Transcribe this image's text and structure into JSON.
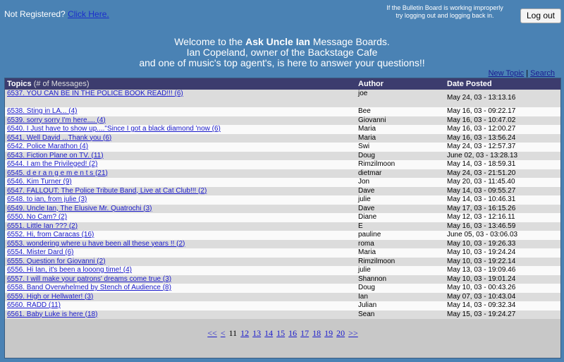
{
  "header": {
    "not_registered": "Not Registered?",
    "click_here": "Click Here.",
    "warning_line1": "If the Bulletin Board is working improperly",
    "warning_line2": "try logging out and logging back in.",
    "logout": "Log out"
  },
  "welcome": {
    "line1_pre": "Welcome to the ",
    "line1_bold": "Ask Uncle Ian",
    "line1_post": " Message Boards.",
    "line2": "Ian Copeland, owner of the Backstage Cafe",
    "line3": "and one of music's top agent's, is here to answer your questions!!"
  },
  "links": {
    "new_topic": "New Topic",
    "sep": "|",
    "search": "Search"
  },
  "table": {
    "col_topics": "Topics",
    "col_topics_sub": "(# of Messages)",
    "col_author": "Author",
    "col_date": "Date Posted",
    "rows": [
      {
        "topic": "6537. YOU CAN BE IN THE POLICE BOOK READ!!! (6)",
        "author": "joe",
        "date": "May 24, 03  -  13:13.16"
      },
      {
        "topic": "6538. Sting in LA... (4)",
        "author": "Bee",
        "date": "May 16, 03  -  09:22.17"
      },
      {
        "topic": "6539. sorry sorry I'm here.... (4)",
        "author": "Giovanni",
        "date": "May 16, 03  -  10:47.02"
      },
      {
        "topic": "6540. I Just have to show up....\"Since I got a black diamond 'now (6)",
        "author": "Maria",
        "date": "May 16, 03  -  12:00.27"
      },
      {
        "topic": "6541. Well David ...Thank you (6)",
        "author": "Maria",
        "date": "May 16, 03  -  13:56.24"
      },
      {
        "topic": "6542. Police Marathon (4)",
        "author": "Swi",
        "date": "May 24, 03  -  12:57.37"
      },
      {
        "topic": "6543. Fiction Plane on TV. (11)",
        "author": "Doug",
        "date": "June 02, 03  -  13:28.13"
      },
      {
        "topic": "6544. I am the Privileged! (2)",
        "author": "Rimzilmoon",
        "date": "May 14, 03  -  18:59.31"
      },
      {
        "topic": "6545. d e r a n g e m e n t s (21)",
        "author": "dietmar",
        "date": "May 24, 03  -  21:51.20"
      },
      {
        "topic": "6546. Kim Turner (9)",
        "author": "Jon",
        "date": "May 20, 03  -  11:45.40"
      },
      {
        "topic": "6547. FALLOUT: The Police Tribute Band, Live at Cat Club!!! (2)",
        "author": "Dave",
        "date": "May 14, 03  -  09:55.27"
      },
      {
        "topic": "6548. to ian, from julie (3)",
        "author": "julie",
        "date": "May 14, 03  -  10:46.31"
      },
      {
        "topic": "6549. Uncle Ian, The Elusive Mr. Quatrochi (3)",
        "author": "Dave",
        "date": "May 17, 03  -  16:15.26"
      },
      {
        "topic": "6550. No Cam? (2)",
        "author": "Diane",
        "date": "May 12, 03  -  12:16.11"
      },
      {
        "topic": "6551. Little Ian ??? (2)",
        "author": "E",
        "date": "May 16, 03  -  13:46.59"
      },
      {
        "topic": "6552. Hi, from Caracas (16)",
        "author": "pauline",
        "date": "June 05, 03  -  03:06.03"
      },
      {
        "topic": "6553. wondering where u have been all these years !! (2)",
        "author": "roma",
        "date": "May 10, 03  -  19:26.33"
      },
      {
        "topic": "6554. Mister Dard (6)",
        "author": "Maria",
        "date": "May 10, 03  -  19:24.24"
      },
      {
        "topic": "6555. Question for Giovanni (2)",
        "author": "Rimzilmoon",
        "date": "May 10, 03  -  19:22.14"
      },
      {
        "topic": "6556. Hi Ian, it's been a looong time! (4)",
        "author": "julie",
        "date": "May 13, 03  -  19:09.46"
      },
      {
        "topic": "6557. I will make your patrons' dreams come true (3)",
        "author": "Shannon",
        "date": "May 10, 03  -  19:01.24"
      },
      {
        "topic": "6558. Band Overwhelmed by Stench of Audience (8)",
        "author": "Doug",
        "date": "May 10, 03  -  00:43.26"
      },
      {
        "topic": "6559. High or Hellwater! (3)",
        "author": "Ian",
        "date": "May 07, 03  -  10:43.04"
      },
      {
        "topic": "6560. RADD (11)",
        "author": "Julian",
        "date": "May 14, 03  -  09:32.34"
      },
      {
        "topic": "6561. Baby Luke is here (18)",
        "author": "Sean",
        "date": "May 15, 03  -  19:24.27"
      }
    ]
  },
  "pager": {
    "first": "<<",
    "prev": "<",
    "current": "11",
    "pages": [
      "12",
      "13",
      "14",
      "15",
      "16",
      "17",
      "18",
      "19",
      "20"
    ],
    "next": ">>"
  }
}
